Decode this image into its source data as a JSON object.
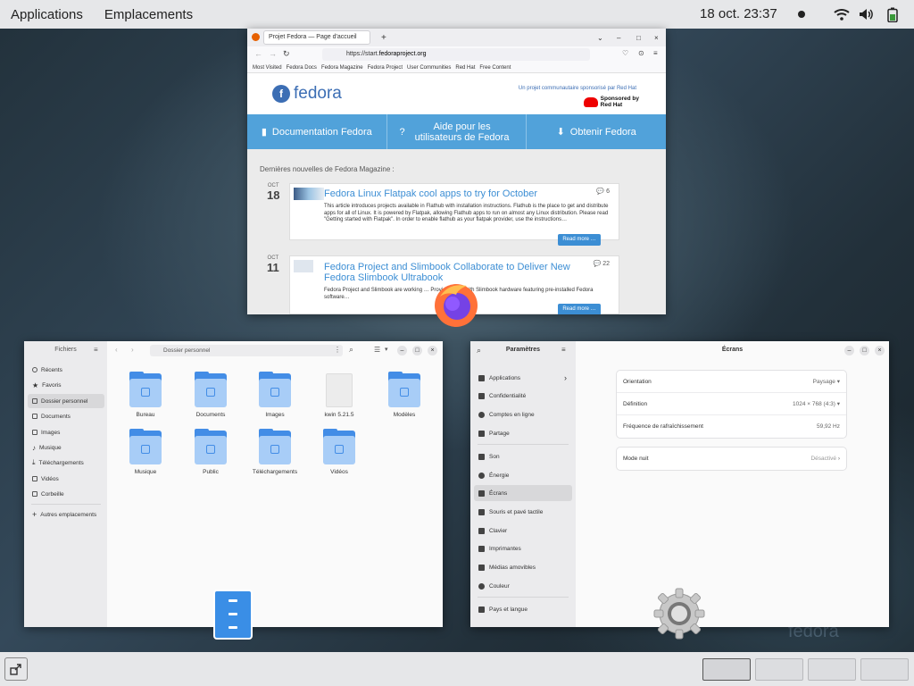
{
  "topbar": {
    "applications": "Applications",
    "places": "Emplacements",
    "clock": "18 oct.  23:37"
  },
  "firefox": {
    "tab_title": "Projet Fedora — Page d'accueil",
    "url_prefix": "https://start.",
    "url_domain": "fedoraproject.org",
    "bookmarks": [
      "Most Visited",
      "Fedora Docs",
      "Fedora Magazine",
      "Fedora Project",
      "User Communities",
      "Red Hat",
      "Free Content"
    ],
    "logo_text": "fedora",
    "sponsor_line": "Un projet communautaire sponsorisé par Red Hat",
    "sponsor_by": "Sponsored by",
    "redhat": "Red Hat",
    "nav": [
      "Documentation Fedora",
      "Aide pour les utilisateurs de Fedora",
      "Obtenir Fedora"
    ],
    "news_heading": "Dernières nouvelles de Fedora Magazine :",
    "news": [
      {
        "month": "OCT",
        "day": "18",
        "title": "Fedora Linux Flatpak cool apps to try for October",
        "comments": "6",
        "excerpt": "This article introduces projects available in Flathub with installation instructions. Flathub is the place to get and distribute apps for all of Linux. It is powered by Flatpak, allowing Flathub apps to run on almost any Linux distribution. Please read \"Getting started with Flatpak\". In order to enable flathub as your flatpak provider, use the instructions…",
        "read_more": "Read more …"
      },
      {
        "month": "OCT",
        "day": "11",
        "title": "Fedora Project and Slimbook Collaborate to Deliver New Fedora Slimbook Ultrabook",
        "comments": "22",
        "excerpt": "Fedora Project and Slimbook are working … Provide users with Slimbook hardware featuring pre-installed Fedora software…",
        "read_more": "Read more …"
      }
    ]
  },
  "files": {
    "title": "Fichiers",
    "path": "Dossier personnel",
    "sidebar": [
      "Récents",
      "Favoris",
      "Dossier personnel",
      "Documents",
      "Images",
      "Musique",
      "Téléchargements",
      "Vidéos",
      "Corbeille",
      "Autres emplacements"
    ],
    "items": [
      "Bureau",
      "Documents",
      "Images",
      "kwin 5.21.5",
      "Modèles",
      "Musique",
      "Public",
      "Téléchargements",
      "Vidéos"
    ]
  },
  "settings": {
    "title": "Paramètres",
    "page_title": "Écrans",
    "sidebar": [
      "Applications",
      "Confidentialité",
      "Comptes en ligne",
      "Partage",
      "Son",
      "Énergie",
      "Écrans",
      "Souris et pavé tactile",
      "Clavier",
      "Imprimantes",
      "Médias amovibles",
      "Couleur",
      "Pays et langue"
    ],
    "rows": [
      {
        "label": "Orientation",
        "value": "Paysage"
      },
      {
        "label": "Définition",
        "value": "1024 × 768 (4:3)"
      },
      {
        "label": "Fréquence de rafraîchissement",
        "value": "59,92 Hz"
      }
    ],
    "night_mode": {
      "label": "Mode nuit",
      "value": "Désactivé"
    }
  },
  "watermark": "fedora",
  "colors": {
    "fedora_blue": "#3c6eb4",
    "nav_blue": "#51a2da",
    "link_blue": "#3c8ed4",
    "folder_blue": "#438de6"
  }
}
